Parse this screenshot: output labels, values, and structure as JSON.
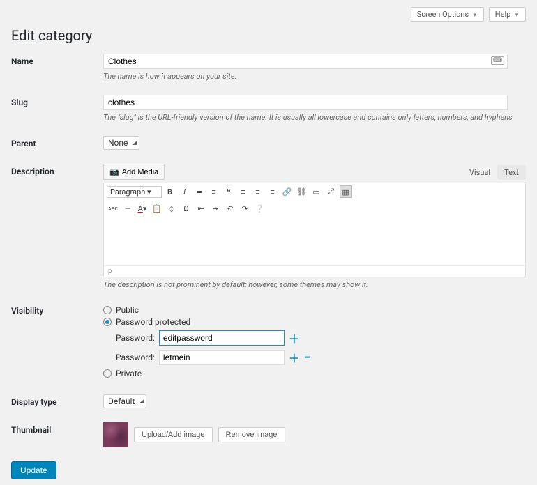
{
  "topbar": {
    "screen_options": "Screen Options",
    "help": "Help"
  },
  "page_title": "Edit category",
  "labels": {
    "name": "Name",
    "slug": "Slug",
    "parent": "Parent",
    "description": "Description",
    "visibility": "Visibility",
    "display_type": "Display type",
    "thumbnail": "Thumbnail"
  },
  "name": {
    "value": "Clothes",
    "hint": "The name is how it appears on your site."
  },
  "slug": {
    "value": "clothes",
    "hint": "The \"slug\" is the URL-friendly version of the name. It is usually all lowercase and contains only letters, numbers, and hyphens."
  },
  "parent": {
    "value": "None"
  },
  "description": {
    "add_media": "Add Media",
    "tab_visual": "Visual",
    "tab_text": "Text",
    "format_select": "Paragraph",
    "status_path": "p",
    "hint": "The description is not prominent by default; however, some themes may show it."
  },
  "visibility": {
    "public": "Public",
    "password_protected": "Password protected",
    "private": "Private",
    "password_label": "Password:",
    "passwords": [
      "editpassword",
      "letmein"
    ]
  },
  "display_type": {
    "value": "Default"
  },
  "thumbnail": {
    "upload": "Upload/Add image",
    "remove": "Remove image"
  },
  "update": "Update"
}
